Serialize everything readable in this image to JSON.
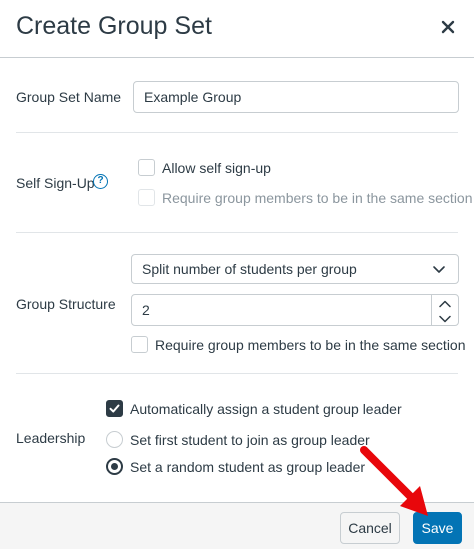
{
  "dialog": {
    "title": "Create Group Set"
  },
  "group_set_name": {
    "label": "Group Set Name",
    "value": "Example Group"
  },
  "self_signup": {
    "label": "Self Sign-Up",
    "help_glyph": "?",
    "allow_label": "Allow self sign-up",
    "allow_checked": false,
    "require_section_label": "Require group members to be in the same section",
    "require_section_checked": false,
    "require_section_disabled": true
  },
  "group_structure": {
    "label": "Group Structure",
    "select_value": "Split number of students per group",
    "number_value": "2",
    "require_section_label": "Require group members to be in the same section",
    "require_section_checked": false
  },
  "leadership": {
    "label": "Leadership",
    "auto_assign_label": "Automatically assign a student group leader",
    "auto_assign_checked": true,
    "option_first_label": "Set first student to join as group leader",
    "option_random_label": "Set a random student as group leader",
    "selected_option": "random"
  },
  "footer": {
    "cancel_label": "Cancel",
    "save_label": "Save"
  },
  "colors": {
    "primary": "#0374b5",
    "text": "#2d3b45",
    "annotation_arrow": "#e8070b"
  }
}
